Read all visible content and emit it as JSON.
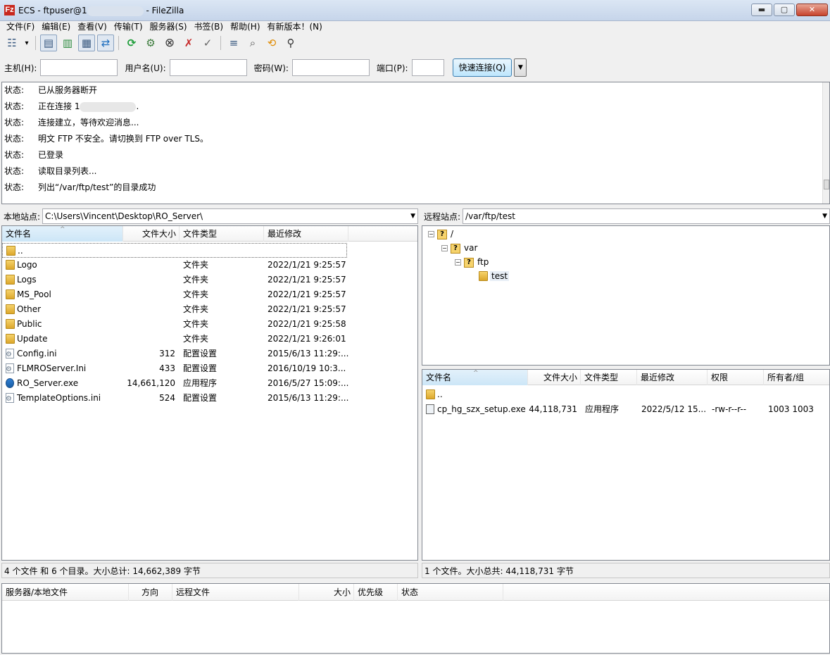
{
  "window": {
    "title_prefix": "ECS - ftpuser@1",
    "title_suffix": "- FileZilla",
    "app_icon_letter": "Fz",
    "min_glyph": "▬",
    "max_glyph": "▢",
    "close_glyph": "✕"
  },
  "menu": [
    "文件(F)",
    "编辑(E)",
    "查看(V)",
    "传输(T)",
    "服务器(S)",
    "书签(B)",
    "帮助(H)",
    "有新版本！(N)"
  ],
  "toolbar": {
    "site_manager_glyph": "☷",
    "dropdown_glyph": "▾",
    "log_glyph": "▤",
    "tree_glyph": "▥",
    "remote_tree_glyph": "▦",
    "queue_glyph": "⇄",
    "refresh_glyph": "⟳",
    "process_glyph": "⚙",
    "cancel_glyph": "⊗",
    "disconnect_glyph": "✗",
    "reconnect_glyph": "✓",
    "filter_glyph": "≡",
    "compare_glyph": "⌕",
    "sync_glyph": "⟲",
    "search_glyph": "⚲"
  },
  "quickconnect": {
    "host_label": "主机(H):",
    "user_label": "用户名(U):",
    "pass_label": "密码(W):",
    "port_label": "端口(P):",
    "host_value": "",
    "user_value": "",
    "pass_value": "",
    "port_value": "",
    "button": "快速连接(Q)",
    "dropdown_glyph": "▼"
  },
  "log": [
    {
      "label": "状态:",
      "text": "已从服务器断开"
    },
    {
      "label": "状态:",
      "text": "正在连接 1",
      "tail": "."
    },
    {
      "label": "状态:",
      "text": "连接建立，等待欢迎消息..."
    },
    {
      "label": "状态:",
      "text": "明文 FTP 不安全。请切换到 FTP over TLS。"
    },
    {
      "label": "状态:",
      "text": "已登录"
    },
    {
      "label": "状态:",
      "text": "读取目录列表..."
    },
    {
      "label": "状态:",
      "text": "列出“/var/ftp/test”的目录成功"
    }
  ],
  "local": {
    "site_label": "本地站点:",
    "path": "C:\\Users\\Vincent\\Desktop\\RO_Server\\",
    "dropdown_glyph": "▼",
    "columns": [
      "文件名",
      "文件大小",
      "文件类型",
      "最近修改"
    ],
    "sort_caret": "^",
    "rows": [
      {
        "name": "..",
        "size": "",
        "type": "",
        "modified": "",
        "icon": "folder"
      },
      {
        "name": "Logo",
        "size": "",
        "type": "文件夹",
        "modified": "2022/1/21 9:25:57",
        "icon": "folder"
      },
      {
        "name": "Logs",
        "size": "",
        "type": "文件夹",
        "modified": "2022/1/21 9:25:57",
        "icon": "folder"
      },
      {
        "name": "MS_Pool",
        "size": "",
        "type": "文件夹",
        "modified": "2022/1/21 9:25:57",
        "icon": "folder"
      },
      {
        "name": "Other",
        "size": "",
        "type": "文件夹",
        "modified": "2022/1/21 9:25:57",
        "icon": "folder"
      },
      {
        "name": "Public",
        "size": "",
        "type": "文件夹",
        "modified": "2022/1/21 9:25:58",
        "icon": "folder"
      },
      {
        "name": "Update",
        "size": "",
        "type": "文件夹",
        "modified": "2022/1/21 9:26:01",
        "icon": "folder"
      },
      {
        "name": "Config.ini",
        "size": "312",
        "type": "配置设置",
        "modified": "2015/6/13 11:29:...",
        "icon": "ini"
      },
      {
        "name": "FLMROServer.Ini",
        "size": "433",
        "type": "配置设置",
        "modified": "2016/10/19 10:3...",
        "icon": "ini"
      },
      {
        "name": "RO_Server.exe",
        "size": "14,661,120",
        "type": "应用程序",
        "modified": "2016/5/27 15:09:...",
        "icon": "exe"
      },
      {
        "name": "TemplateOptions.ini",
        "size": "524",
        "type": "配置设置",
        "modified": "2015/6/13 11:29:...",
        "icon": "ini"
      }
    ],
    "status": "4 个文件 和 6 个目录。大小总计: 14,662,389 字节"
  },
  "remote": {
    "site_label": "远程站点:",
    "path": "/var/ftp/test",
    "dropdown_glyph": "▼",
    "tree": [
      {
        "label": "/",
        "toggle": "−",
        "icon": "question"
      },
      {
        "label": "var",
        "toggle": "−",
        "icon": "question"
      },
      {
        "label": "ftp",
        "toggle": "−",
        "icon": "question"
      },
      {
        "label": "test",
        "toggle": "",
        "icon": "folder"
      }
    ],
    "columns": [
      "文件名",
      "文件大小",
      "文件类型",
      "最近修改",
      "权限",
      "所有者/组"
    ],
    "sort_caret": "^",
    "rows": [
      {
        "name": "..",
        "size": "",
        "type": "",
        "modified": "",
        "perms": "",
        "owner": "",
        "icon": "folder"
      },
      {
        "name": "cp_hg_szx_setup.exe",
        "size": "44,118,731",
        "type": "应用程序",
        "modified": "2022/5/12 15...",
        "perms": "-rw-r--r--",
        "owner": "1003 1003",
        "icon": "exe2"
      }
    ],
    "status": "1 个文件。大小总共: 44,118,731 字节"
  },
  "queue": {
    "columns": [
      "服务器/本地文件",
      "方向",
      "远程文件",
      "大小",
      "优先级",
      "状态"
    ]
  }
}
